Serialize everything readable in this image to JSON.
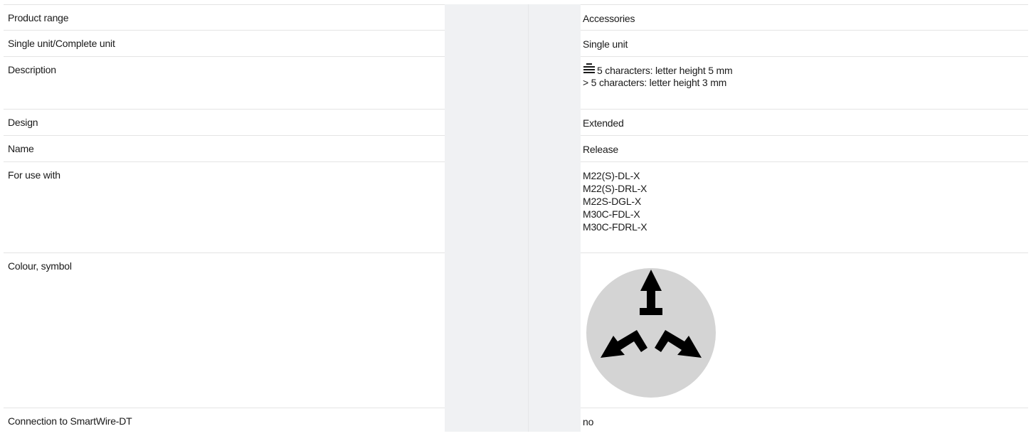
{
  "rows": [
    {
      "label": "Product range",
      "value": "Accessories"
    },
    {
      "label": "Single unit/Complete unit",
      "value": "Single unit"
    },
    {
      "label": "Description",
      "lines": [
        "5 characters: letter height 5 mm",
        "> 5 characters: letter height 3 mm"
      ]
    },
    {
      "label": "Design",
      "value": "Extended"
    },
    {
      "label": "Name",
      "value": "Release"
    },
    {
      "label": "For use with",
      "lines": [
        "M22(S)-DL-X",
        "M22(S)-DRL-X",
        "M22S-DGL-X",
        "M30C-FDL-X",
        "M30C-FDRL-X"
      ]
    },
    {
      "label": "Colour, symbol",
      "symbol": "release-symbol-icon"
    },
    {
      "label": "Connection to SmartWire-DT",
      "value": "no"
    }
  ],
  "colors": {
    "symbol_disc": "#d4d4d4",
    "symbol_arrows": "#000000",
    "shaded_column": "#f0f1f3",
    "row_border": "#e4e4e4"
  }
}
